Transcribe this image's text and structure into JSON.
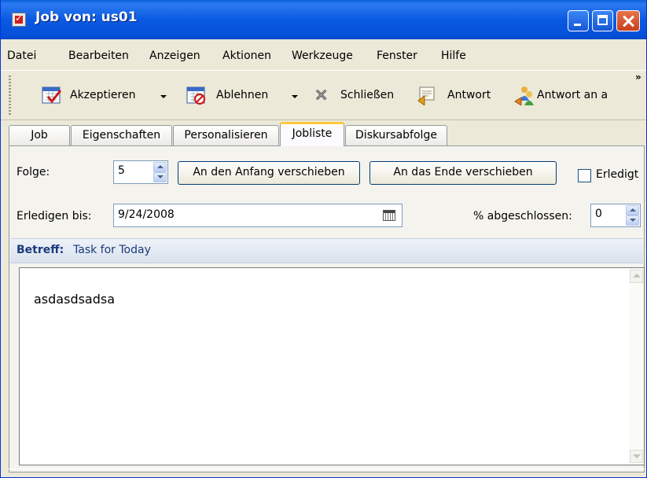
{
  "window": {
    "title": "Job von: us01"
  },
  "menu": [
    "Datei",
    "Bearbeiten",
    "Anzeigen",
    "Aktionen",
    "Werkzeuge",
    "Fenster",
    "Hilfe"
  ],
  "toolbar": {
    "accept": "Akzeptieren",
    "decline": "Ablehnen",
    "close": "Schließen",
    "reply": "Antwort",
    "reply_to": "Antwort an a",
    "overflow": "»"
  },
  "tabs": [
    "Job",
    "Eigenschaften",
    "Personalisieren",
    "Jobliste",
    "Diskursabfolge"
  ],
  "active_tab": "Jobliste",
  "form": {
    "sequence_label": "Folge:",
    "sequence_value": "5",
    "move_top_button": "An den Anfang verschieben",
    "move_end_button": "An das Ende verschieben",
    "done_label": "Erledigt",
    "done_checked": false,
    "due_label": "Erledigen bis:",
    "due_value": "9/24/2008",
    "percent_label": "% abgeschlossen:",
    "percent_value": "0"
  },
  "subject": {
    "label": "Betreff:",
    "value": "Task for Today"
  },
  "message": {
    "body": "asdasdsadsa"
  }
}
